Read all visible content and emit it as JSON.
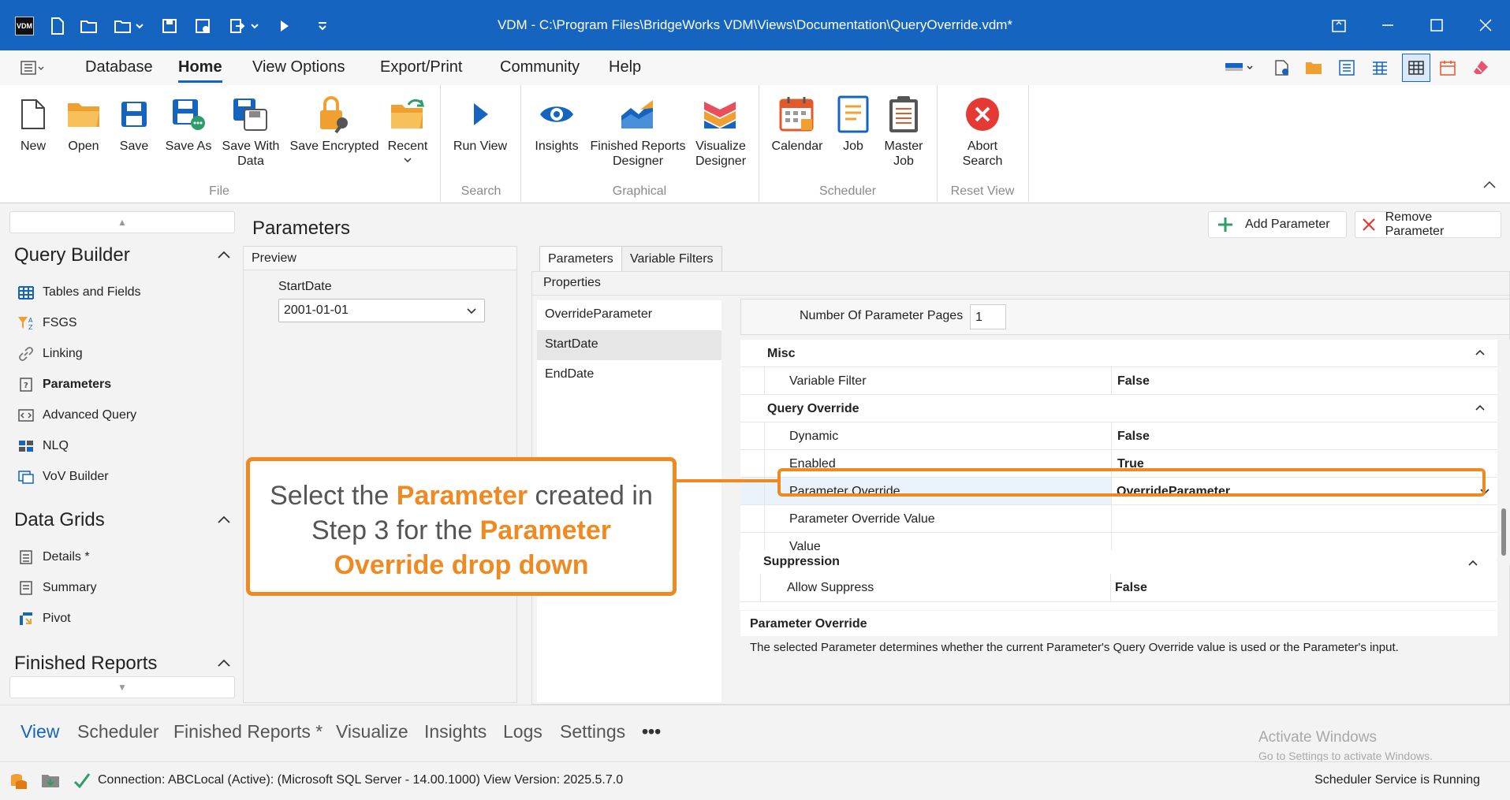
{
  "window": {
    "title": "VDM - C:\\Program Files\\BridgeWorks VDM\\Views\\Documentation\\QueryOverride.vdm*",
    "app_logo": "VDM"
  },
  "menu": {
    "tabs": [
      "Database",
      "Home",
      "View Options",
      "Export/Print",
      "Community",
      "Help"
    ],
    "active_tab": "Home"
  },
  "ribbon": {
    "groups": [
      {
        "label": "File",
        "buttons": [
          "New",
          "Open",
          "Save",
          "Save As",
          "Save With Data",
          "Save Encrypted",
          "Recent"
        ]
      },
      {
        "label": "Search",
        "buttons": [
          "Run View"
        ]
      },
      {
        "label": "Graphical",
        "buttons": [
          "Insights",
          "Finished Reports Designer",
          "Visualize Designer"
        ]
      },
      {
        "label": "Scheduler",
        "buttons": [
          "Calendar",
          "Job",
          "Master Job"
        ]
      },
      {
        "label": "Reset View",
        "buttons": [
          "Abort Search"
        ]
      }
    ]
  },
  "sidebar": {
    "query_builder": {
      "title": "Query Builder",
      "items": [
        "Tables and Fields",
        "FSGS",
        "Linking",
        "Parameters",
        "Advanced Query",
        "NLQ",
        "VoV Builder"
      ]
    },
    "data_grids": {
      "title": "Data Grids",
      "items": [
        "Details *",
        "Summary",
        "Pivot"
      ]
    },
    "finished_reports": {
      "title": "Finished Reports"
    }
  },
  "main": {
    "title": "Parameters",
    "add_button": "Add Parameter",
    "remove_button": "Remove Parameter",
    "preview": {
      "header": "Preview",
      "field_label": "StartDate",
      "field_value": "2001-01-01"
    },
    "tabs": [
      "Parameters",
      "Variable Filters"
    ],
    "properties_header": "Properties",
    "parameter_list": [
      "OverrideParameter",
      "StartDate",
      "EndDate"
    ],
    "selected_parameter": "StartDate",
    "num_pages_label": "Number Of Parameter Pages",
    "num_pages_value": "1",
    "grid": {
      "misc_title": "Misc",
      "variable_filter_label": "Variable Filter",
      "variable_filter_value": "False",
      "query_override_title": "Query Override",
      "dynamic_label": "Dynamic",
      "dynamic_value": "False",
      "enabled_label": "Enabled",
      "enabled_value": "True",
      "param_override_label": "Parameter Override",
      "param_override_value": "OverrideParameter",
      "param_override_value_label": "Parameter Override Value",
      "value_label": "Value",
      "suppression_title": "Suppression",
      "allow_suppress_label": "Allow Suppress",
      "allow_suppress_value": "False"
    },
    "description": {
      "title": "Parameter Override",
      "text": "The selected Parameter determines whether the current Parameter's Query Override value is used or the Parameter's input."
    }
  },
  "callout": {
    "part1": "Select the ",
    "part2": "Parameter",
    "part3": " created in Step 3 for the ",
    "part4": "Parameter Override drop down"
  },
  "bottom_tabs": [
    "View",
    "Scheduler",
    "Finished Reports *",
    "Visualize",
    "Insights",
    "Logs",
    "Settings"
  ],
  "bottom_more": "•••",
  "status": {
    "connection": "Connection: ABCLocal (Active): (Microsoft SQL Server - 14.00.1000) View Version: 2025.5.7.0",
    "scheduler": "Scheduler Service is Running",
    "watermark_title": "Activate Windows",
    "watermark_sub": "Go to Settings to activate Windows."
  },
  "colors": {
    "titlebar": "#1565c0",
    "accent_orange": "#ef8a22",
    "link_blue": "#1565c0"
  }
}
